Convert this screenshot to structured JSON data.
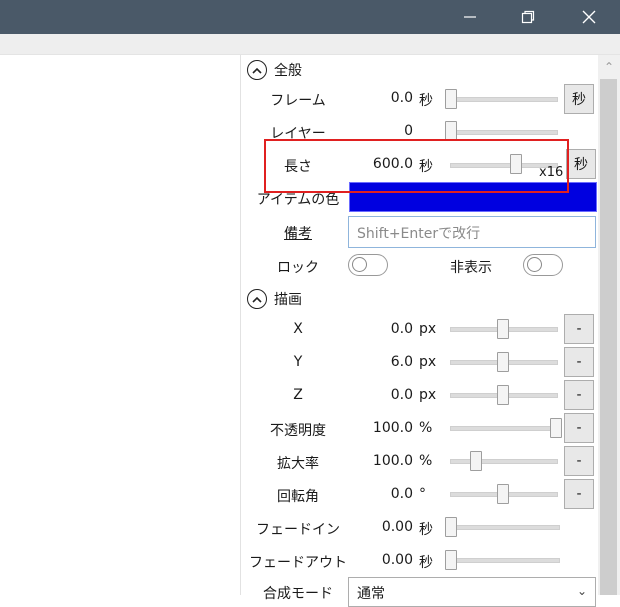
{
  "window": {
    "minimize_icon": "minimize-icon",
    "maximize_icon": "restore-icon",
    "close_icon": "close-icon"
  },
  "panel": {
    "general": {
      "title": "全般",
      "frame": {
        "label": "フレーム",
        "value": "0.0",
        "unit": "秒",
        "button": "秒"
      },
      "layer": {
        "label": "レイヤー",
        "value": "0"
      },
      "length": {
        "label": "長さ",
        "value": "600.0",
        "unit": "秒",
        "button": "秒",
        "multiplier": "x16"
      },
      "item_color": {
        "label": "アイテムの色",
        "color": "#0000e0"
      },
      "memo": {
        "label": "備考",
        "placeholder": "Shift+Enterで改行"
      },
      "lock": {
        "label": "ロック",
        "on": false
      },
      "hidden": {
        "label": "非表示",
        "on": false
      }
    },
    "draw": {
      "title": "描画",
      "rows": [
        {
          "key": "x",
          "label": "X",
          "value": "0.0",
          "unit": "px",
          "button": "-"
        },
        {
          "key": "y",
          "label": "Y",
          "value": "6.0",
          "unit": "px",
          "button": "-"
        },
        {
          "key": "z",
          "label": "Z",
          "value": "0.0",
          "unit": "px",
          "button": "-"
        },
        {
          "key": "opacity",
          "label": "不透明度",
          "value": "100.0",
          "unit": "%",
          "button": "-"
        },
        {
          "key": "scale",
          "label": "拡大率",
          "value": "100.0",
          "unit": "%",
          "button": "-"
        },
        {
          "key": "rotation",
          "label": "回転角",
          "value": "0.0",
          "unit": "°",
          "button": "-"
        },
        {
          "key": "fadein",
          "label": "フェードイン",
          "value": "0.00",
          "unit": "秒"
        },
        {
          "key": "fadeout",
          "label": "フェードアウト",
          "value": "0.00",
          "unit": "秒"
        }
      ],
      "blend_mode": {
        "label": "合成モード",
        "value": "通常"
      }
    }
  }
}
